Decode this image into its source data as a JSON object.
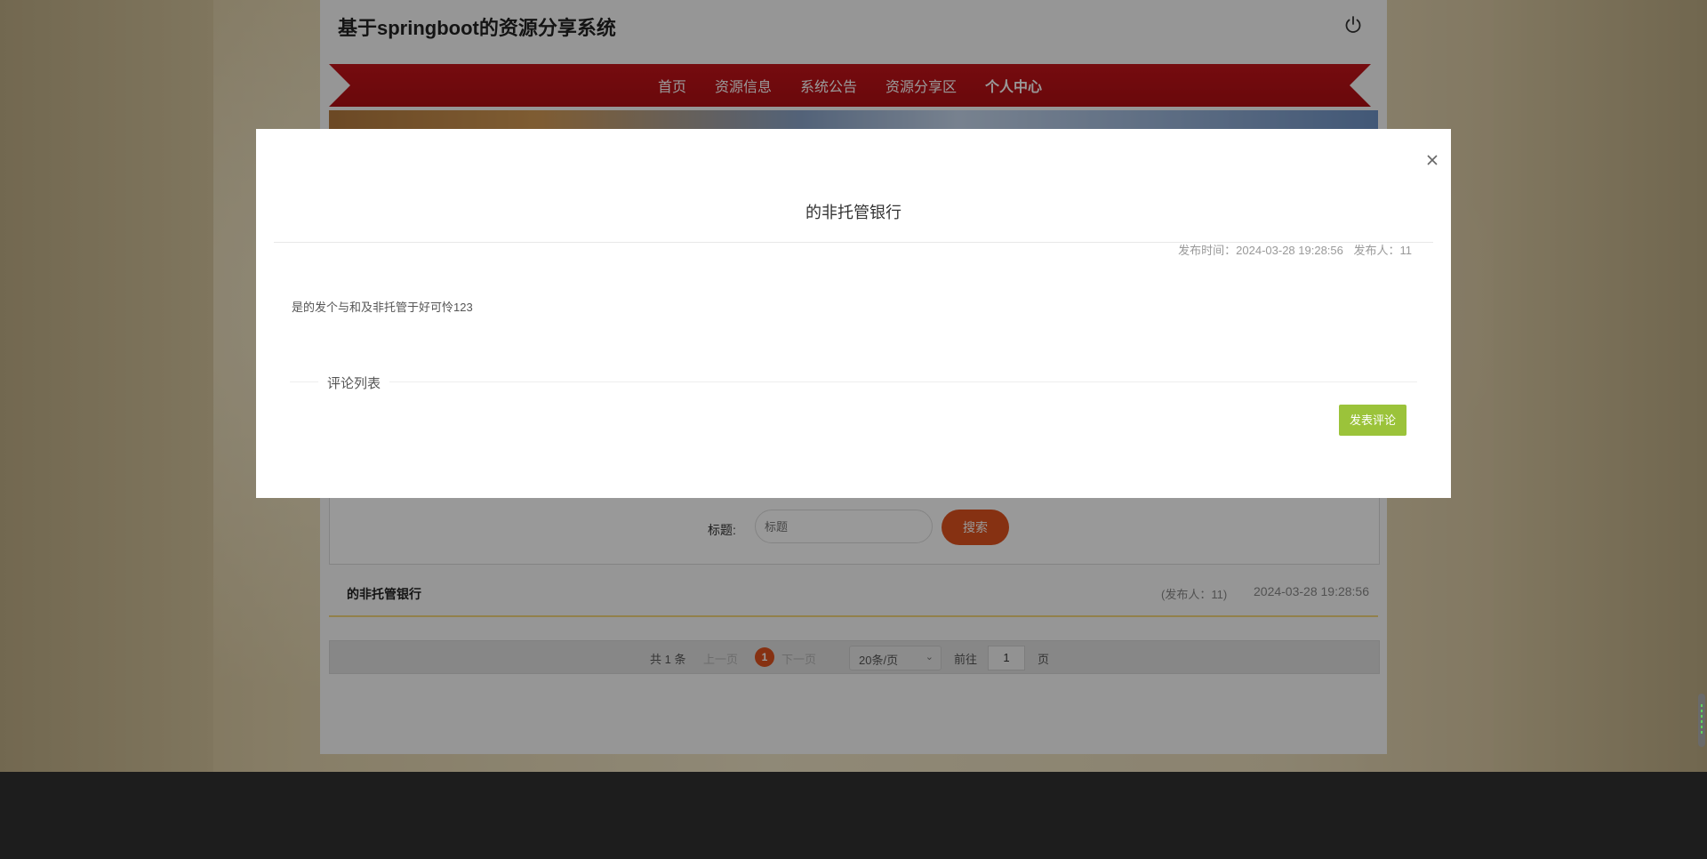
{
  "site": {
    "title": "基于springboot的资源分享系统",
    "icon_power": "power-icon"
  },
  "nav": {
    "items": [
      {
        "label": "首页"
      },
      {
        "label": "资源信息"
      },
      {
        "label": "系统公告"
      },
      {
        "label": "资源分享区"
      },
      {
        "label": "个人中心"
      }
    ],
    "active_index": 4
  },
  "search": {
    "label": "标题:",
    "placeholder": "标题",
    "button": "搜索"
  },
  "list": [
    {
      "title": "的非托管银行",
      "publisher": "(发布人：11)",
      "time": "2024-03-28 19:28:56"
    }
  ],
  "pagination": {
    "total": "共 1 条",
    "prev": "上一页",
    "current_page": "1",
    "next": "下一页",
    "page_size": "20条/页",
    "goto_label": "前往",
    "goto_value": "1",
    "page_suffix": "页"
  },
  "modal": {
    "title": "的非托管银行",
    "publish_time": "发布时间：2024-03-28 19:28:56",
    "publisher": "发布人：11",
    "content": "是的发个与和及非托管于好可怜123",
    "comments_label": "评论列表",
    "comment_button": "发表评论",
    "close_icon": "close-icon"
  },
  "colors": {
    "nav_red": "#c4141a",
    "accent_orange": "#e0531f",
    "comment_green": "#9bc33a"
  }
}
